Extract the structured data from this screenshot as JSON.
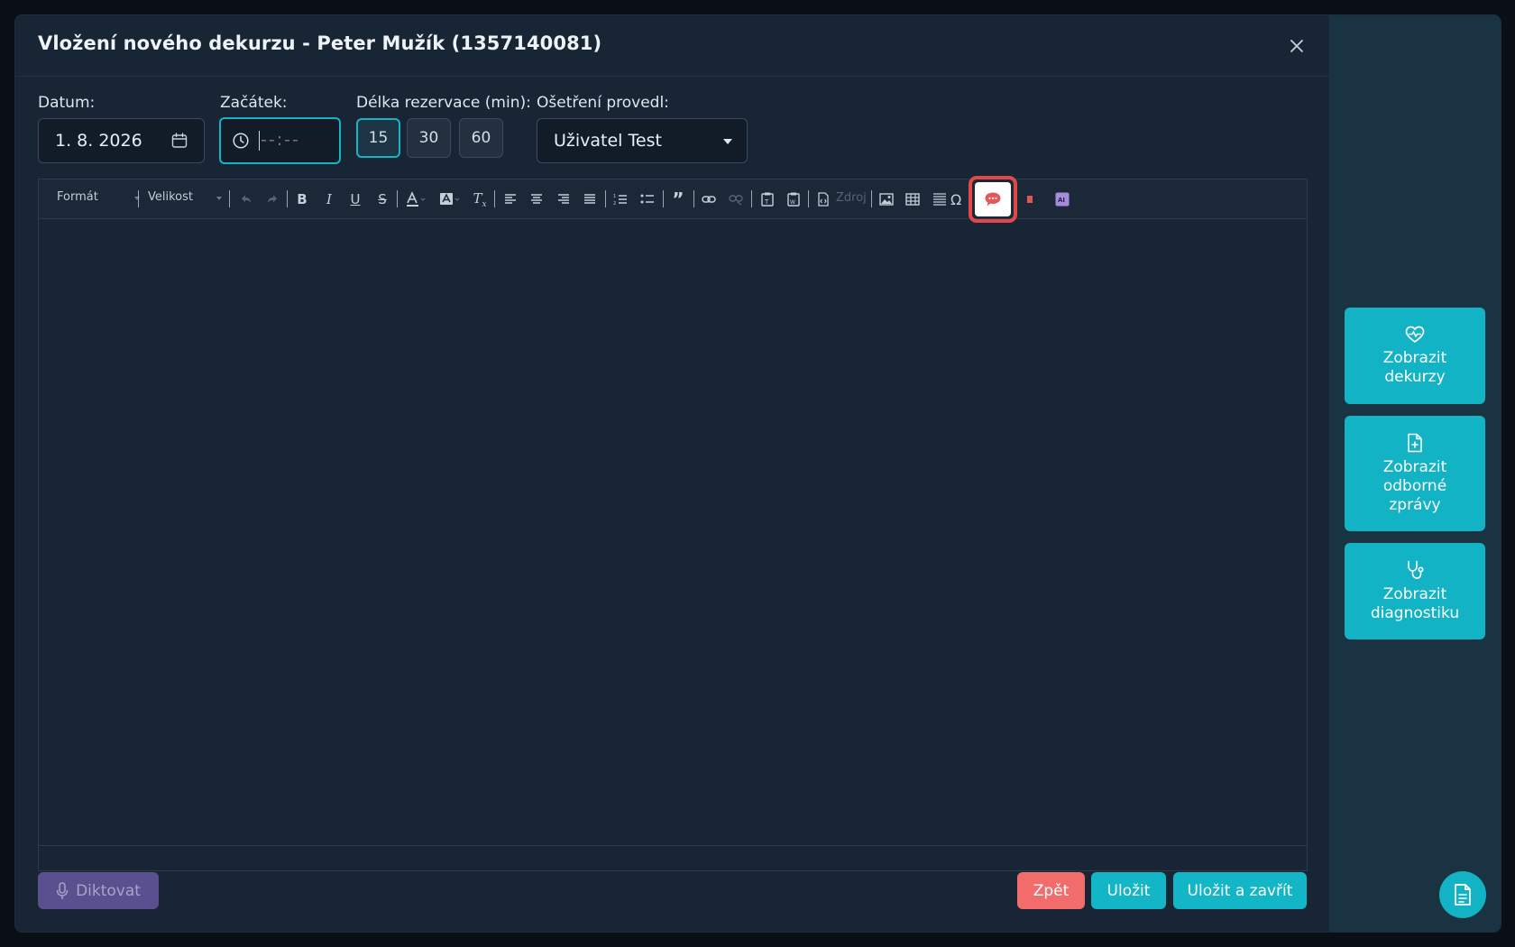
{
  "modal": {
    "title": "Vložení nového dekurzu - Peter Mužík (1357140081)"
  },
  "form": {
    "date_label": "Datum:",
    "date_value": "1. 8. 2026",
    "start_label": "Začátek:",
    "start_placeholder": "--:--",
    "duration_label": "Délka rezervace (min):",
    "durations": [
      "15",
      "30",
      "60"
    ],
    "duration_selected": "15",
    "performed_label": "Ošetření provedl:",
    "performed_value": "Uživatel Test"
  },
  "toolbar": {
    "format_label": "Formát",
    "size_label": "Velikost",
    "source_label": "Zdroj",
    "ai_label": "AI",
    "icons": [
      "undo-icon",
      "redo-icon",
      "bold-icon",
      "italic-icon",
      "underline-icon",
      "strikethrough-icon",
      "text-color-icon",
      "background-color-icon",
      "remove-format-icon",
      "align-left-icon",
      "align-center-icon",
      "align-right-icon",
      "align-justify-icon",
      "numbered-list-icon",
      "bulleted-list-icon",
      "blockquote-icon",
      "link-icon",
      "unlink-icon",
      "paste-text-icon",
      "paste-word-icon",
      "source-icon",
      "image-icon",
      "table-icon",
      "horizontal-line-icon",
      "special-char-icon",
      "speech-bubble-icon",
      "ai-icon"
    ]
  },
  "footer": {
    "dictate_label": "Diktovat",
    "back_label": "Zpět",
    "save_label": "Uložit",
    "save_close_label": "Uložit a zavřít"
  },
  "sidebar": {
    "items": [
      {
        "label_lines": [
          "Zobrazit",
          "dekurzy"
        ],
        "icon": "heart-pulse-icon"
      },
      {
        "label_lines": [
          "Zobrazit",
          "odborné",
          "zprávy"
        ],
        "icon": "file-plus-icon"
      },
      {
        "label_lines": [
          "Zobrazit",
          "diagnostiku"
        ],
        "icon": "stethoscope-icon"
      }
    ]
  },
  "colors": {
    "accent": "#12b3c4",
    "danger": "#f26c6c",
    "dictate": "#5a4f8f",
    "modal_bg": "#182535",
    "highlight": "#e2484a"
  }
}
